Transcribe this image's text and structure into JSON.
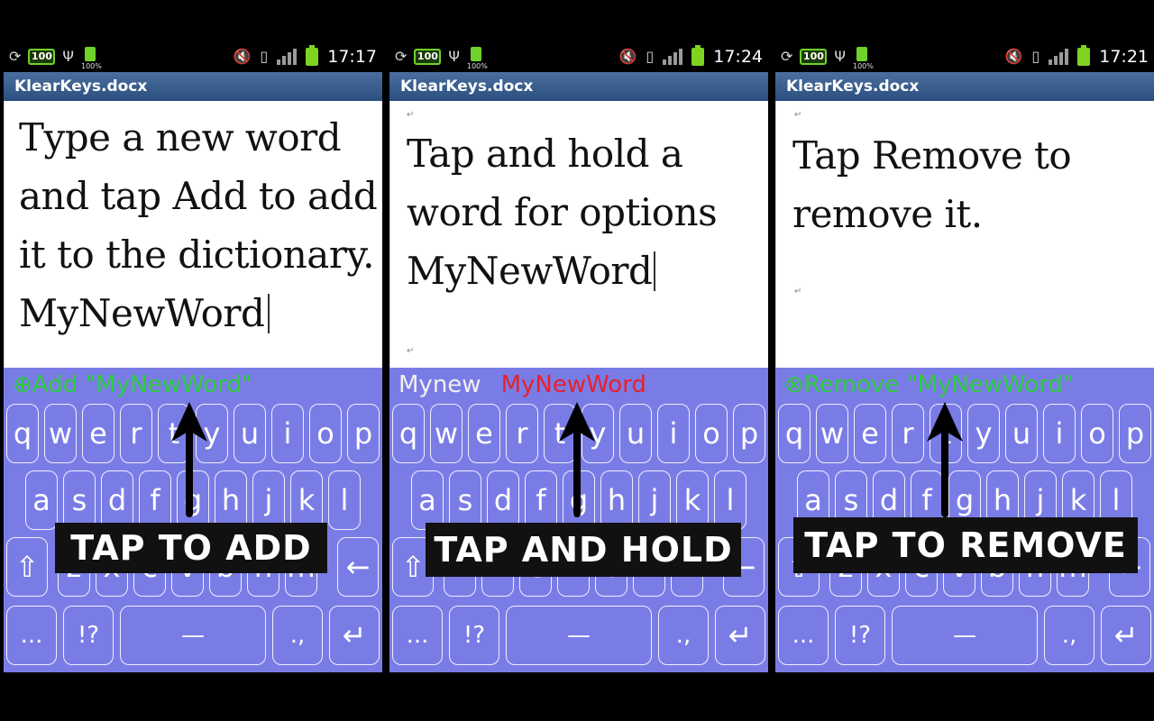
{
  "panels": [
    {
      "status": {
        "battery_badge": "100",
        "battery_pct_text": "100%",
        "time": "17:17"
      },
      "title": "KlearKeys.docx",
      "doc_lines": [
        "Type a new word",
        "and tap Add to add",
        "it to the dictionary.",
        "MyNewWord"
      ],
      "suggestion": {
        "icon": "⊕",
        "text": "Add \"MyNewWord\""
      },
      "label": "TAP TO ADD"
    },
    {
      "status": {
        "battery_badge": "100",
        "battery_pct_text": "100%",
        "time": "17:24"
      },
      "title": "KlearKeys.docx",
      "doc_lines": [
        "Tap and hold a",
        "word for options",
        "MyNewWord"
      ],
      "suggestion": {
        "word1": "Mynew",
        "word2": "MyNewWord"
      },
      "label": "TAP AND HOLD"
    },
    {
      "status": {
        "battery_badge": "100",
        "battery_pct_text": "100%",
        "time": "17:21"
      },
      "title": "KlearKeys.docx",
      "doc_lines": [
        "Tap Remove to",
        "remove it."
      ],
      "suggestion": {
        "icon": "⊗",
        "text": "Remove \"MyNewWord\""
      },
      "label": "TAP TO REMOVE"
    }
  ],
  "keyboard": {
    "row1": [
      "q",
      "w",
      "e",
      "r",
      "t",
      "y",
      "u",
      "i",
      "o",
      "p"
    ],
    "row2": [
      "a",
      "s",
      "d",
      "f",
      "g",
      "h",
      "j",
      "k",
      "l"
    ],
    "row3_letters": [
      "z",
      "x",
      "c",
      "v",
      "b",
      "n",
      "m"
    ],
    "shift": "⇧",
    "backspace": "←",
    "row4": {
      "ellipsis": "...",
      "punct": "!?",
      "space": "—",
      "dot_comma": ".,",
      "enter": "↵"
    }
  },
  "colors": {
    "keyboard_bg": "#7a7ce6",
    "suggest_green": "#2ecc40",
    "suggest_red": "#e8202a",
    "titlebar": "#2b4e7e"
  }
}
